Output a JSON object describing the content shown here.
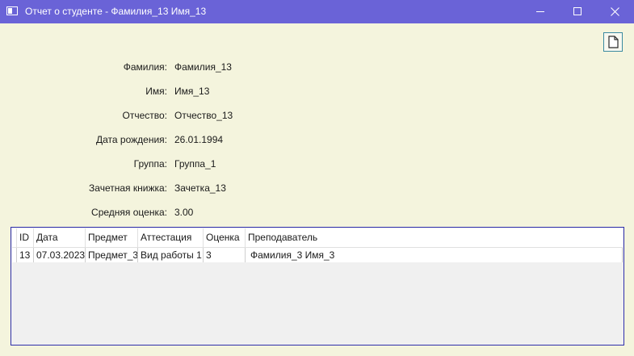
{
  "window": {
    "title": "Отчет о студенте - Фамилия_13 Имя_13"
  },
  "toolbar": {
    "icons": {
      "document": "document-icon",
      "close": "close-icon",
      "minimize": "minimize-icon",
      "maximize": "maximize-icon"
    }
  },
  "student": {
    "fields": [
      {
        "label": "Фамилия:",
        "value": "Фамилия_13"
      },
      {
        "label": "Имя:",
        "value": "Имя_13"
      },
      {
        "label": "Отчество:",
        "value": "Отчество_13"
      },
      {
        "label": "Дата рождения:",
        "value": "26.01.1994"
      },
      {
        "label": "Группа:",
        "value": "Группа_1"
      },
      {
        "label": "Зачетная книжка:",
        "value": "Зачетка_13"
      },
      {
        "label": "Средняя оценка:",
        "value": "3.00"
      }
    ]
  },
  "grades_table": {
    "columns": [
      "ID",
      "Дата",
      "Предмет",
      "Аттестация",
      "Оценка",
      "Преподаватель"
    ],
    "rows": [
      [
        "13",
        "07.03.2023",
        "Предмет_3",
        "Вид работы 1",
        "3",
        "Фамилия_3 Имя_3"
      ]
    ]
  },
  "colors": {
    "titlebar": "#6a63d7",
    "background": "#f4f4dd",
    "grid_border": "#2e2eab"
  }
}
